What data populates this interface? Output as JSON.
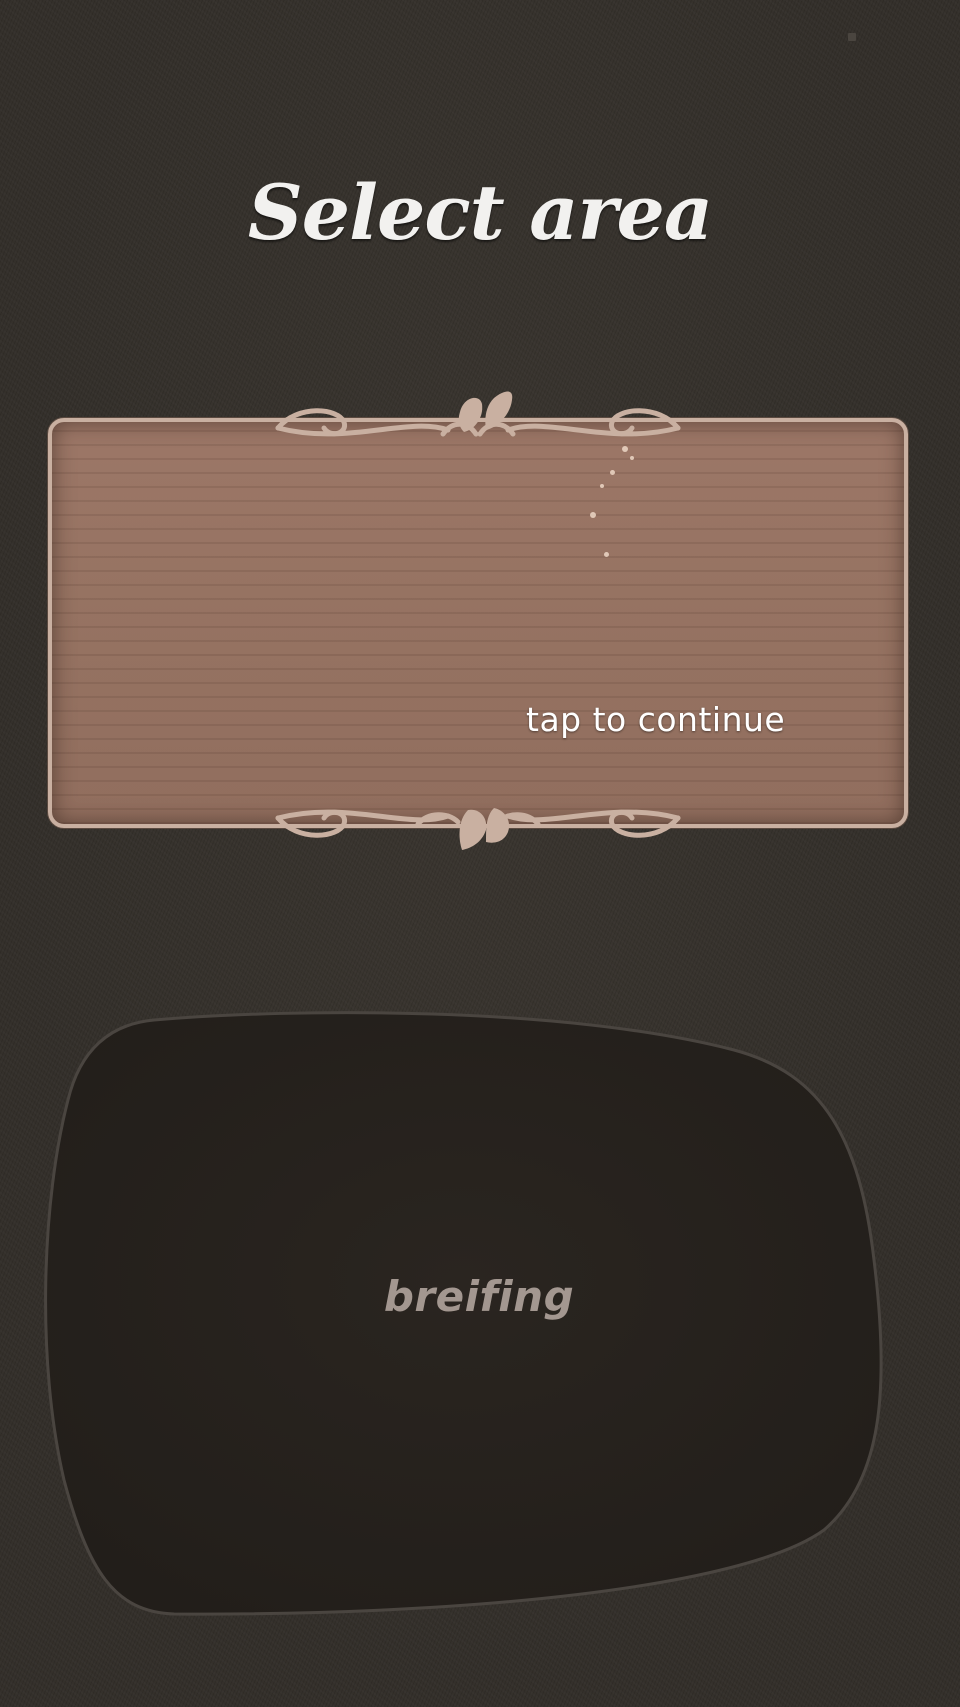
{
  "screen": {
    "title": "Select area"
  },
  "area_card": {
    "action_label": "tap to continue"
  },
  "briefing": {
    "label": "breifing"
  },
  "colors": {
    "background": "#322e29",
    "plank": "#94705f",
    "frame": "#c9b0a1",
    "briefing_panel": "#25211d",
    "title_text": "#f2f1ef",
    "briefing_text": "#a39790"
  }
}
